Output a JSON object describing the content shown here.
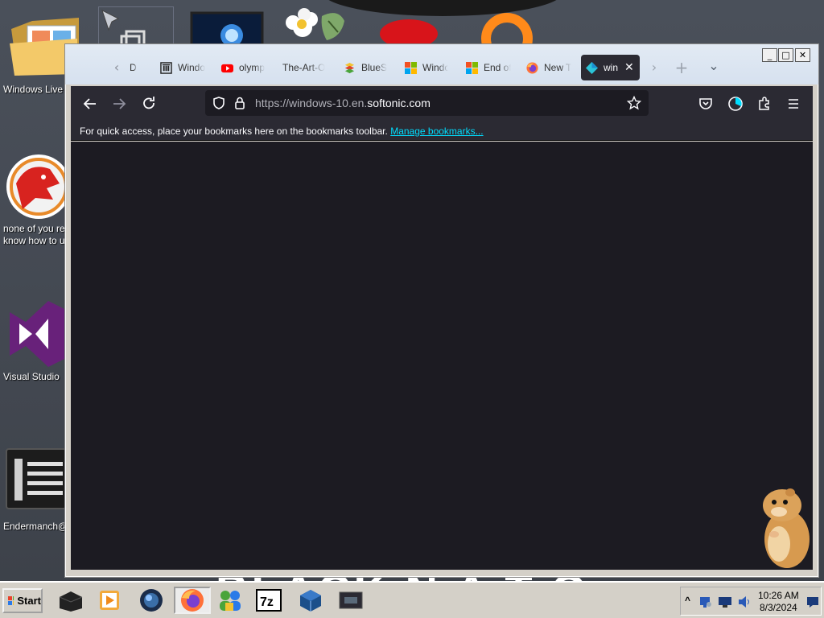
{
  "desktop": {
    "icons": [
      {
        "label": "Windows Live"
      },
      {
        "label": "none of you re know how to u"
      },
      {
        "label": "Visual Studio"
      },
      {
        "label": "Endermanch@"
      }
    ],
    "watermark": "BLACK N A T O"
  },
  "window": {
    "caption_buttons": {
      "minimize": "_",
      "maximize": "□",
      "close": "✕"
    },
    "tabs": [
      {
        "title": "D",
        "icon": "generic-page-icon"
      },
      {
        "title": "Windo",
        "icon": "archive-icon"
      },
      {
        "title": "olymp",
        "icon": "youtube-icon"
      },
      {
        "title": "The-Art-O",
        "icon": "none"
      },
      {
        "title": "BlueS",
        "icon": "bluestacks-icon"
      },
      {
        "title": "Windo",
        "icon": "microsoft-icon"
      },
      {
        "title": "End of",
        "icon": "microsoft-icon"
      },
      {
        "title": "New T",
        "icon": "firefox-icon"
      },
      {
        "title": "win",
        "icon": "softonic-icon",
        "active": true
      }
    ],
    "new_tab_symbol": "+",
    "list_tabs_symbol": "⌄",
    "url": {
      "prefix": "https://windows-10.en.",
      "domain": "softonic.com"
    },
    "bookmarks_bar": {
      "message": "For quick access, place your bookmarks here on the bookmarks toolbar.",
      "link": "Manage bookmarks..."
    }
  },
  "taskbar": {
    "start_label": "Start",
    "clock": {
      "time": "10:26 AM",
      "date": "8/3/2024"
    },
    "tray_expand": "^"
  },
  "colors": {
    "toolbar": "#2b2a33",
    "content": "#1c1b22",
    "link": "#00ddff",
    "titlebar": "#d6e1ef"
  }
}
